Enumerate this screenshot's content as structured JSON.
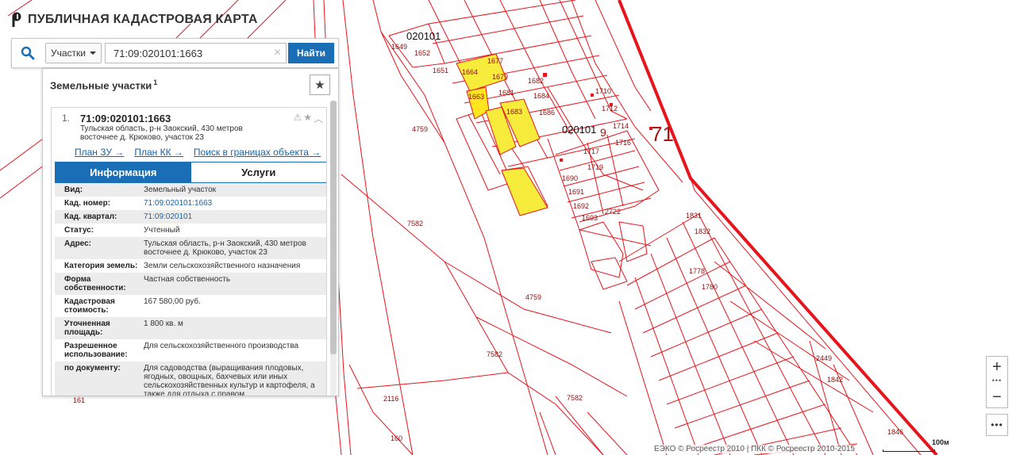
{
  "app": {
    "title": "ПУБЛИЧНАЯ КАДАСТРОВАЯ КАРТА"
  },
  "search": {
    "type_label": "Участки",
    "query": "71:09:020101:1663",
    "find_label": "Найти"
  },
  "panel": {
    "title": "Земельные участки",
    "title_sup": "1",
    "record": {
      "num": "1.",
      "id": "71:09:020101:1663",
      "address": "Тульская область, р-н Заокский, 430 метров восточнее д. Крюково, участок 23",
      "links": [
        "План ЗУ →",
        "План КК →",
        "Поиск в границах объекта →"
      ]
    },
    "tabs": [
      "Информация",
      "Услуги"
    ],
    "props": [
      {
        "k": "Вид:",
        "v": "Земельный участок"
      },
      {
        "k": "Кад. номер:",
        "v": "71:09:020101:1663"
      },
      {
        "k": "Кад. квартал:",
        "v": "71:09:020101"
      },
      {
        "k": "Статус:",
        "v": "Учтенный"
      },
      {
        "k": "Адрес:",
        "v": "Тульская область, р-н Заокский, 430 метров восточнее д. Крюково, участок 23"
      },
      {
        "k": "Категория земель:",
        "v": "Земли сельскохозяйственного назначения"
      },
      {
        "k": "Форма собственности:",
        "v": "Частная собственность"
      },
      {
        "k": "Кадастровая стоимость:",
        "v": "167 580,00 руб."
      },
      {
        "k": "Уточненная площадь:",
        "v": "1 800 кв. м"
      },
      {
        "k": "Разрешенное использование:",
        "v": "Для сельскохозяйственного производства"
      },
      {
        "k": "по документу:",
        "v": "Для садоводства (выращивания плодовых, ягодных, овощных, бахчевых или иных сельскохозяйственных культур и картофеля, а также для отдыха с правом"
      }
    ]
  },
  "map": {
    "labels": {
      "q_020101": "020101",
      "q_020101b": "020101",
      "q_9": "9",
      "region_71": "71",
      "p4759a": "4759",
      "p4759b": "4759",
      "p7582a": "7582",
      "p7582b": "7582",
      "p7582c": "7582",
      "p2116": "2116",
      "p160": "160",
      "p161": "161",
      "p1649": "1649",
      "p1652": "1652",
      "p1651": "1651",
      "p1663": "1663",
      "p1664": "1664",
      "p1677": "1677",
      "p1679": "1679",
      "p1681": "1681",
      "p1682": "1682",
      "p1683": "1683",
      "p1684": "1684",
      "p1686": "1686",
      "p1710": "1710",
      "p1712": "1712",
      "p1714": "1714",
      "p1716": "1716",
      "p1717": "1717",
      "p1719": "1719",
      "p1690": "1690",
      "p1691": "1691",
      "p1692": "1692",
      "p1693": "1693",
      "p2722": "2722",
      "p1831": "1831",
      "p1832": "1832",
      "p1778": "1778",
      "p1780": "1780",
      "p1842": "1842",
      "p1846": "1846",
      "p2449": "2449"
    },
    "attribution": "ЕЭКО © Росреестр 2010 | ПКК © Росреестр 2010-2015",
    "scale": "100м",
    "colors": {
      "parcel": "#e8141c",
      "selected": "#f7ec3b",
      "highlight": "#ffe51f"
    }
  },
  "controls": {
    "zoom_in": "+",
    "zoom_mid": "•••",
    "zoom_out": "−",
    "more": "•••"
  }
}
